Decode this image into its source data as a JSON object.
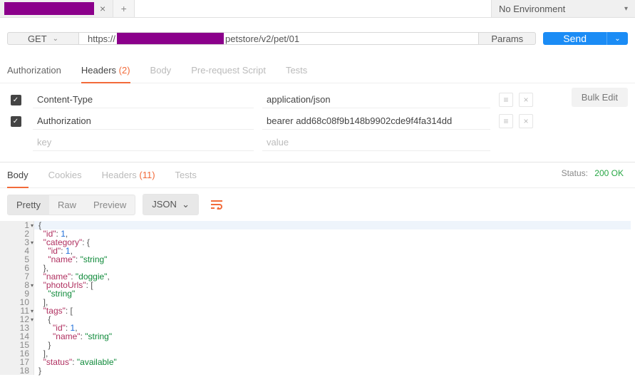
{
  "environment": {
    "label": "No Environment"
  },
  "request": {
    "method": "GET",
    "url_prefix": "https://",
    "url_suffix": "petstore/v2/pet/01",
    "params_label": "Params",
    "send_label": "Send"
  },
  "req_tabs": {
    "authorization": "Authorization",
    "headers": "Headers",
    "headers_count": "(2)",
    "body": "Body",
    "prerequest": "Pre-request Script",
    "tests": "Tests"
  },
  "headers": {
    "bulk_edit": "Bulk Edit",
    "rows": [
      {
        "checked": true,
        "key": "Content-Type",
        "value": "application/json"
      },
      {
        "checked": true,
        "key": "Authorization",
        "value": "bearer add68c08f9b148b9902cde9f4fa314dd"
      }
    ],
    "placeholder_key": "key",
    "placeholder_value": "value"
  },
  "resp_tabs": {
    "body": "Body",
    "cookies": "Cookies",
    "headers": "Headers",
    "headers_count": "(11)",
    "tests": "Tests"
  },
  "status": {
    "label": "Status:",
    "code": "200 OK"
  },
  "fmt": {
    "pretty": "Pretty",
    "raw": "Raw",
    "preview": "Preview",
    "format": "JSON"
  },
  "response_body": {
    "id": 1,
    "category": {
      "id": 1,
      "name": "string"
    },
    "name": "doggie",
    "photoUrls": [
      "string"
    ],
    "tags": [
      {
        "id": 1,
        "name": "string"
      }
    ],
    "status": "available"
  },
  "code_lines": [
    {
      "n": 1,
      "fold": true,
      "hl": true,
      "tokens": [
        [
          "p",
          "{"
        ]
      ]
    },
    {
      "n": 2,
      "tokens": [
        [
          "p",
          "  "
        ],
        [
          "k",
          "\"id\""
        ],
        [
          "p",
          ": "
        ],
        [
          "n",
          "1"
        ],
        [
          "p",
          ","
        ]
      ]
    },
    {
      "n": 3,
      "fold": true,
      "tokens": [
        [
          "p",
          "  "
        ],
        [
          "k",
          "\"category\""
        ],
        [
          "p",
          ": {"
        ]
      ]
    },
    {
      "n": 4,
      "tokens": [
        [
          "p",
          "    "
        ],
        [
          "k",
          "\"id\""
        ],
        [
          "p",
          ": "
        ],
        [
          "n",
          "1"
        ],
        [
          "p",
          ","
        ]
      ]
    },
    {
      "n": 5,
      "tokens": [
        [
          "p",
          "    "
        ],
        [
          "k",
          "\"name\""
        ],
        [
          "p",
          ": "
        ],
        [
          "s",
          "\"string\""
        ]
      ]
    },
    {
      "n": 6,
      "tokens": [
        [
          "p",
          "  },"
        ]
      ]
    },
    {
      "n": 7,
      "tokens": [
        [
          "p",
          "  "
        ],
        [
          "k",
          "\"name\""
        ],
        [
          "p",
          ": "
        ],
        [
          "s",
          "\"doggie\""
        ],
        [
          "p",
          ","
        ]
      ]
    },
    {
      "n": 8,
      "fold": true,
      "tokens": [
        [
          "p",
          "  "
        ],
        [
          "k",
          "\"photoUrls\""
        ],
        [
          "p",
          ": ["
        ]
      ]
    },
    {
      "n": 9,
      "tokens": [
        [
          "p",
          "    "
        ],
        [
          "s",
          "\"string\""
        ]
      ]
    },
    {
      "n": 10,
      "tokens": [
        [
          "p",
          "  ],"
        ]
      ]
    },
    {
      "n": 11,
      "fold": true,
      "tokens": [
        [
          "p",
          "  "
        ],
        [
          "k",
          "\"tags\""
        ],
        [
          "p",
          ": ["
        ]
      ]
    },
    {
      "n": 12,
      "fold": true,
      "tokens": [
        [
          "p",
          "    {"
        ]
      ]
    },
    {
      "n": 13,
      "tokens": [
        [
          "p",
          "      "
        ],
        [
          "k",
          "\"id\""
        ],
        [
          "p",
          ": "
        ],
        [
          "n",
          "1"
        ],
        [
          "p",
          ","
        ]
      ]
    },
    {
      "n": 14,
      "tokens": [
        [
          "p",
          "      "
        ],
        [
          "k",
          "\"name\""
        ],
        [
          "p",
          ": "
        ],
        [
          "s",
          "\"string\""
        ]
      ]
    },
    {
      "n": 15,
      "tokens": [
        [
          "p",
          "    }"
        ]
      ]
    },
    {
      "n": 16,
      "tokens": [
        [
          "p",
          "  ],"
        ]
      ]
    },
    {
      "n": 17,
      "tokens": [
        [
          "p",
          "  "
        ],
        [
          "k",
          "\"status\""
        ],
        [
          "p",
          ": "
        ],
        [
          "s",
          "\"available\""
        ]
      ]
    },
    {
      "n": 18,
      "tokens": [
        [
          "p",
          "}"
        ]
      ]
    }
  ]
}
